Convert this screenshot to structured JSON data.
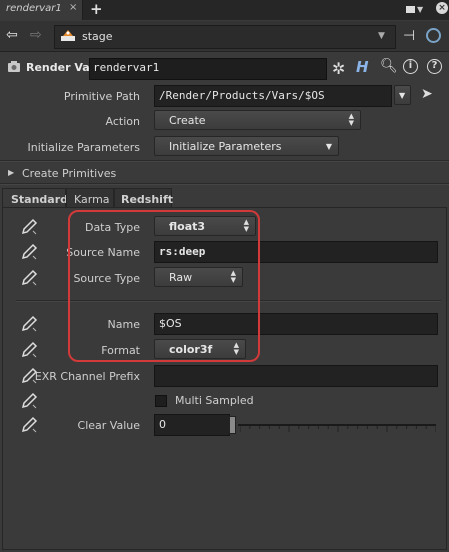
{
  "tab": {
    "title": "rendervar1",
    "close": "×",
    "add": "+"
  },
  "window": {
    "close": "×"
  },
  "pathbar": {
    "path": "stage"
  },
  "node": {
    "type_label": "Render Var",
    "name": "rendervar1",
    "info": "i",
    "help": "?",
    "h": "H"
  },
  "params": {
    "primitive_path": {
      "label": "Primitive Path",
      "value": "/Render/Products/Vars/$OS"
    },
    "action": {
      "label": "Action",
      "value": "Create"
    },
    "initialize": {
      "label": "Initialize Parameters",
      "value": "Initialize Parameters"
    },
    "create_primitives": {
      "label": "Create Primitives"
    }
  },
  "tabs": [
    {
      "label": "Standard",
      "active": true
    },
    {
      "label": "Karma",
      "active": false
    },
    {
      "label": "Redshift",
      "active": false
    }
  ],
  "standard": {
    "data_type": {
      "label": "Data Type",
      "value": "float3"
    },
    "source_name": {
      "label": "Source Name",
      "value": "rs:deep"
    },
    "source_type": {
      "label": "Source Type",
      "value": "Raw"
    },
    "name": {
      "label": "Name",
      "value": "$OS"
    },
    "format": {
      "label": "Format",
      "value": "color3f"
    },
    "exr_channel_prefix": {
      "label": "EXR Channel Prefix",
      "value": ""
    },
    "multi_sampled": {
      "label": "Multi Sampled",
      "checked": false
    },
    "clear_value": {
      "label": "Clear Value",
      "value": "0",
      "slider_fraction": 0.0
    }
  },
  "colors": {
    "highlight": "#d23a3a",
    "background": "#3a3a3a",
    "accent": "#8ab4e6"
  }
}
